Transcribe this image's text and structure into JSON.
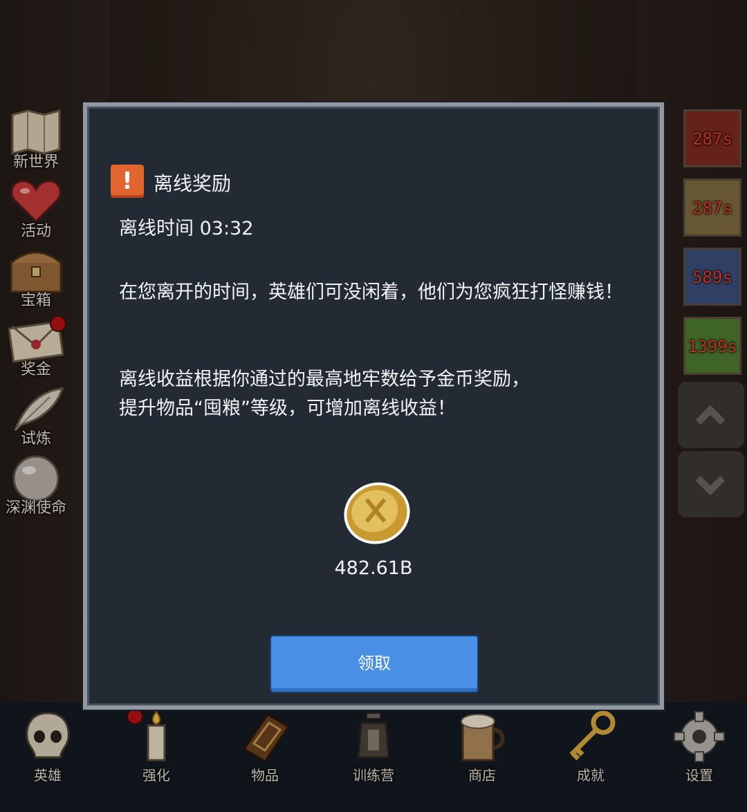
{
  "side_menu": [
    {
      "label": "新世界",
      "icon": "map-icon"
    },
    {
      "label": "活动",
      "icon": "heart-icon"
    },
    {
      "label": "宝箱",
      "icon": "chest-icon"
    },
    {
      "label": "奖金",
      "icon": "envelope-icon"
    },
    {
      "label": "试炼",
      "icon": "feather-icon"
    },
    {
      "label": "深渊使命",
      "icon": "orb-icon"
    }
  ],
  "right_timers": [
    "287s",
    "287s",
    "589s",
    "1399s"
  ],
  "dialog": {
    "title": "离线奖励",
    "offline_time": "离线时间 03:32",
    "message1": "在您离开的时间，英雄们可没闲着，他们为您疯狂打怪赚钱！",
    "message2_line1": "离线收益根据你通过的最高地牢数给予金币奖励，",
    "message2_line2": "提升物品“囤粮”等级，可增加离线收益！",
    "reward_amount": "482.61B",
    "claim_label": "领取"
  },
  "bottom_tabs": [
    {
      "label": "英雄",
      "icon": "skull-icon"
    },
    {
      "label": "强化",
      "icon": "candle-icon"
    },
    {
      "label": "物品",
      "icon": "book-icon"
    },
    {
      "label": "训练营",
      "icon": "lantern-icon"
    },
    {
      "label": "商店",
      "icon": "mug-icon"
    },
    {
      "label": "成就",
      "icon": "key-icon"
    },
    {
      "label": "设置",
      "icon": "gear-icon"
    }
  ],
  "colors": {
    "dialog_bg": "#242a33",
    "dialog_border": "#8f98a3",
    "warning": "#e2642e",
    "claim_button": "#4a8fe6",
    "timer_text": "#e43b2a"
  }
}
